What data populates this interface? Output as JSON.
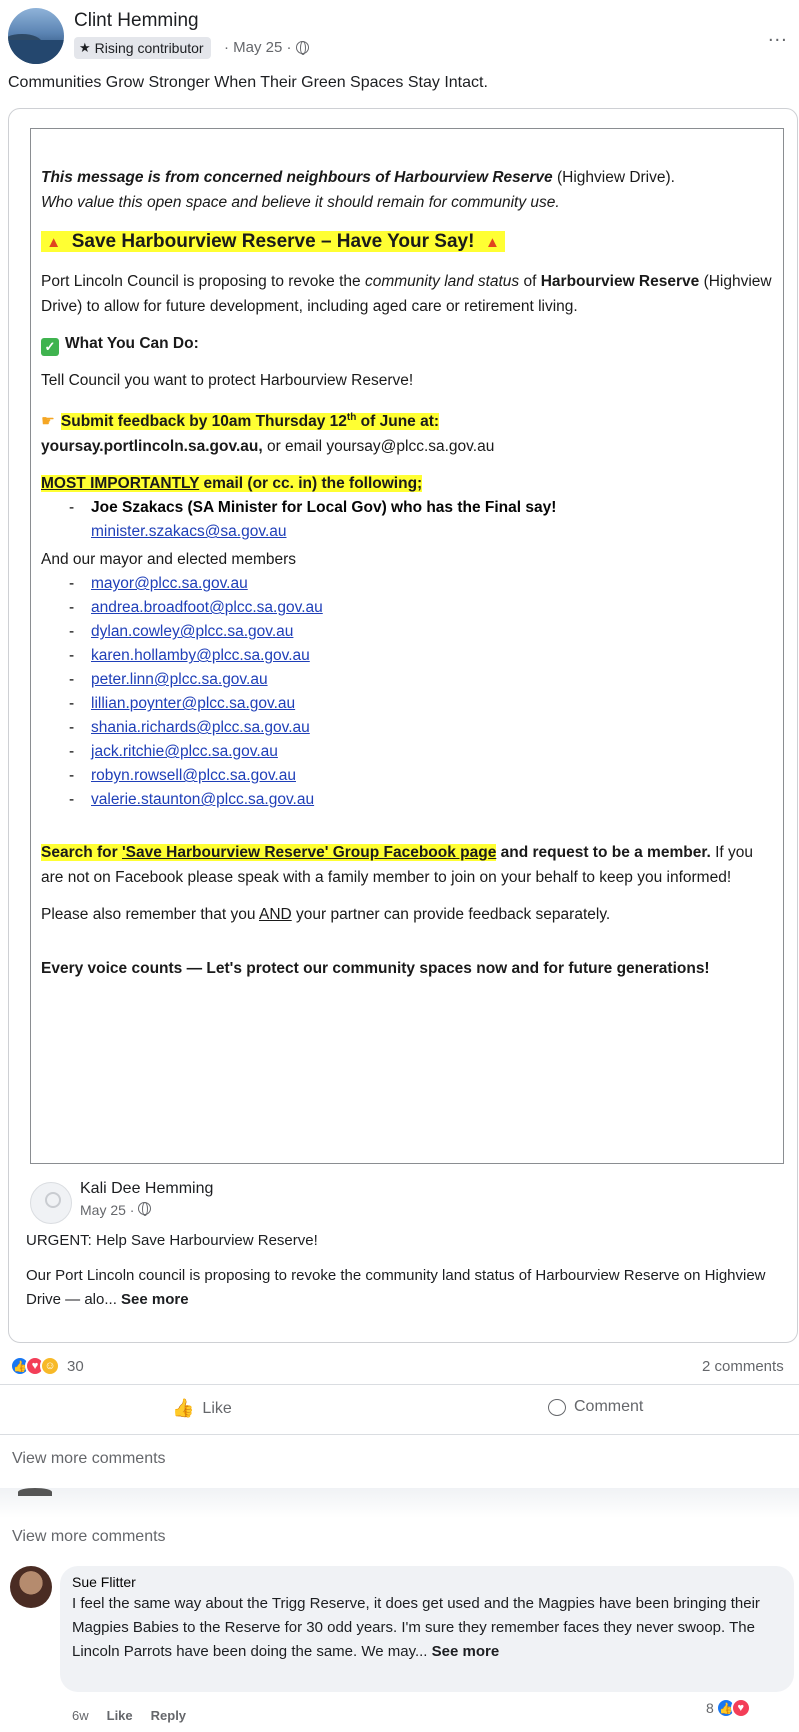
{
  "post": {
    "author": "Clint Hemming",
    "badge": "Rising contributor",
    "date": "· May 25 ·",
    "more": "...",
    "caption": "Communities Grow Stronger When Their Green Spaces Stay Intact."
  },
  "flyer": {
    "intro_bold": "This message is from concerned neighbours of Harbourview Reserve",
    "intro_rest": " (Highview Drive).",
    "intro_line2": "Who value this open space and believe it should remain for community use.",
    "headline": "Save Harbourview Reserve – Have Your Say!",
    "p1_a": "Port Lincoln Council is proposing to revoke the ",
    "p1_italic": "community land status",
    "p1_b": " of ",
    "p1_bold": "Harbourview Reserve",
    "p1_c": " (Highview Drive) to allow for future development, including aged care or retirement living.",
    "what_heading": "What You Can Do:",
    "tell": "Tell Council you want to protect Harbourview Reserve!",
    "submit_a": "Submit feedback by 10am Thursday 12",
    "submit_sup": "th",
    "submit_b": " of June at:",
    "site_bold": "yoursay.portlincoln.sa.gov.au,",
    "site_rest": " or email yoursay@plcc.sa.gov.au",
    "most_underline": "MOST IMPORTANTLY",
    "most_rest": " email (or cc. in) the following;",
    "minister": "Joe Szakacs (SA Minister for Local Gov) who has the Final say!",
    "minister_email": "minister.szakacs@sa.gov.au",
    "mayor_line": "And our mayor and elected members",
    "emails": [
      "mayor@plcc.sa.gov.au",
      "andrea.broadfoot@plcc.sa.gov.au",
      "dylan.cowley@plcc.sa.gov.au",
      "karen.hollamby@plcc.sa.gov.au",
      "peter.linn@plcc.sa.gov.au",
      "lillian.poynter@plcc.sa.gov.au",
      "shania.richards@plcc.sa.gov.au",
      "jack.ritchie@plcc.sa.gov.au",
      "robyn.rowsell@plcc.sa.gov.au",
      "valerie.staunton@plcc.sa.gov.au"
    ],
    "search_a": "Search for ",
    "search_u": "'Save Harbourview Reserve' Group Facebook page",
    "search_b": " and request to be a member.",
    "search_rest": " If you are not on Facebook please speak with a family member to join on your behalf to keep you informed!",
    "partner_a": "Please also remember that you ",
    "partner_u": "AND",
    "partner_b": " your partner can provide feedback separately.",
    "every": "Every voice counts — Let's protect our community spaces now and for future generations!"
  },
  "inner": {
    "name": "Kali Dee Hemming",
    "date": "May 25 ·",
    "urgent": "URGENT: Help Save Harbourview Reserve!",
    "body": "Our Port Lincoln council is proposing to revoke the community land status of Harbourview Reserve on Highview Drive — alo...",
    "see_more": "See more"
  },
  "engagement": {
    "reaction_count": "30",
    "comments": "2 comments",
    "like": "Like",
    "comment": "Comment",
    "view_more_1": "View more comments",
    "view_more_2": "View more comments"
  },
  "comment": {
    "name": "Sue Flitter",
    "text": "I feel the same way about the Trigg Reserve, it does get used and the Magpies have been bringing their Magpies Babies to the Reserve for 30 odd years. I'm sure they remember faces they never swoop. The Lincoln Parrots have been doing the same. We may...",
    "see_more": "See more",
    "time": "6w",
    "like": "Like",
    "reply": "Reply",
    "react_count": "8"
  },
  "colors": {
    "highlight": "#ffff33",
    "link": "#1f3fb8",
    "like_blue": "#1877f2",
    "love_red": "#f33e58"
  }
}
